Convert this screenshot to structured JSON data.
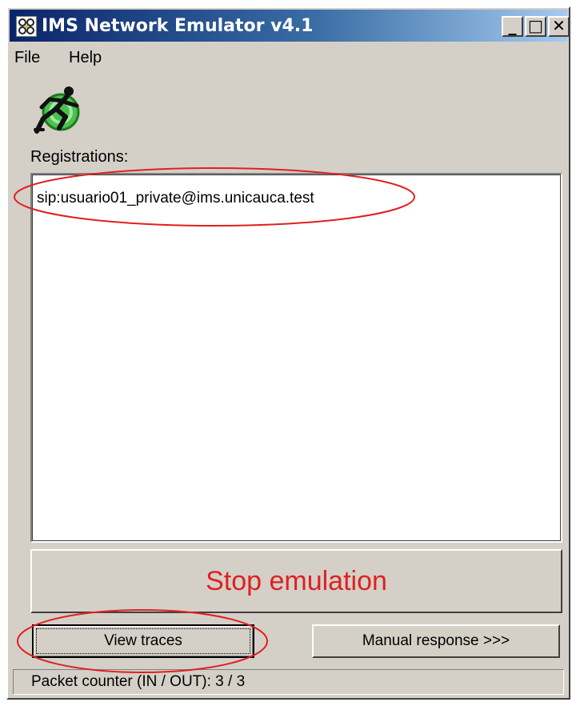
{
  "window": {
    "title": "IMS Network Emulator v4.1",
    "app_icon": "network-nodes-icon",
    "controls": {
      "minimize_glyph": "_",
      "maximize_glyph": "□",
      "close_glyph": "✕"
    }
  },
  "menu": {
    "items": [
      {
        "label": "File"
      },
      {
        "label": "Help"
      }
    ]
  },
  "logo": {
    "icon": "running-man-globe-icon"
  },
  "registrations": {
    "label": "Registrations:",
    "items": [
      "sip:usuario01_private@ims.unicauca.test"
    ]
  },
  "buttons": {
    "stop_emulation": "Stop emulation",
    "view_traces": "View traces",
    "manual_response": "Manual response >>>"
  },
  "status": {
    "packet_counter": "Packet counter (IN / OUT): 3 / 3"
  },
  "colors": {
    "title_gradient_start": "#0a246a",
    "title_gradient_end": "#a6caf0",
    "window_face": "#d4d0c8",
    "stop_text": "#e02020",
    "annotation": "#e02020"
  }
}
